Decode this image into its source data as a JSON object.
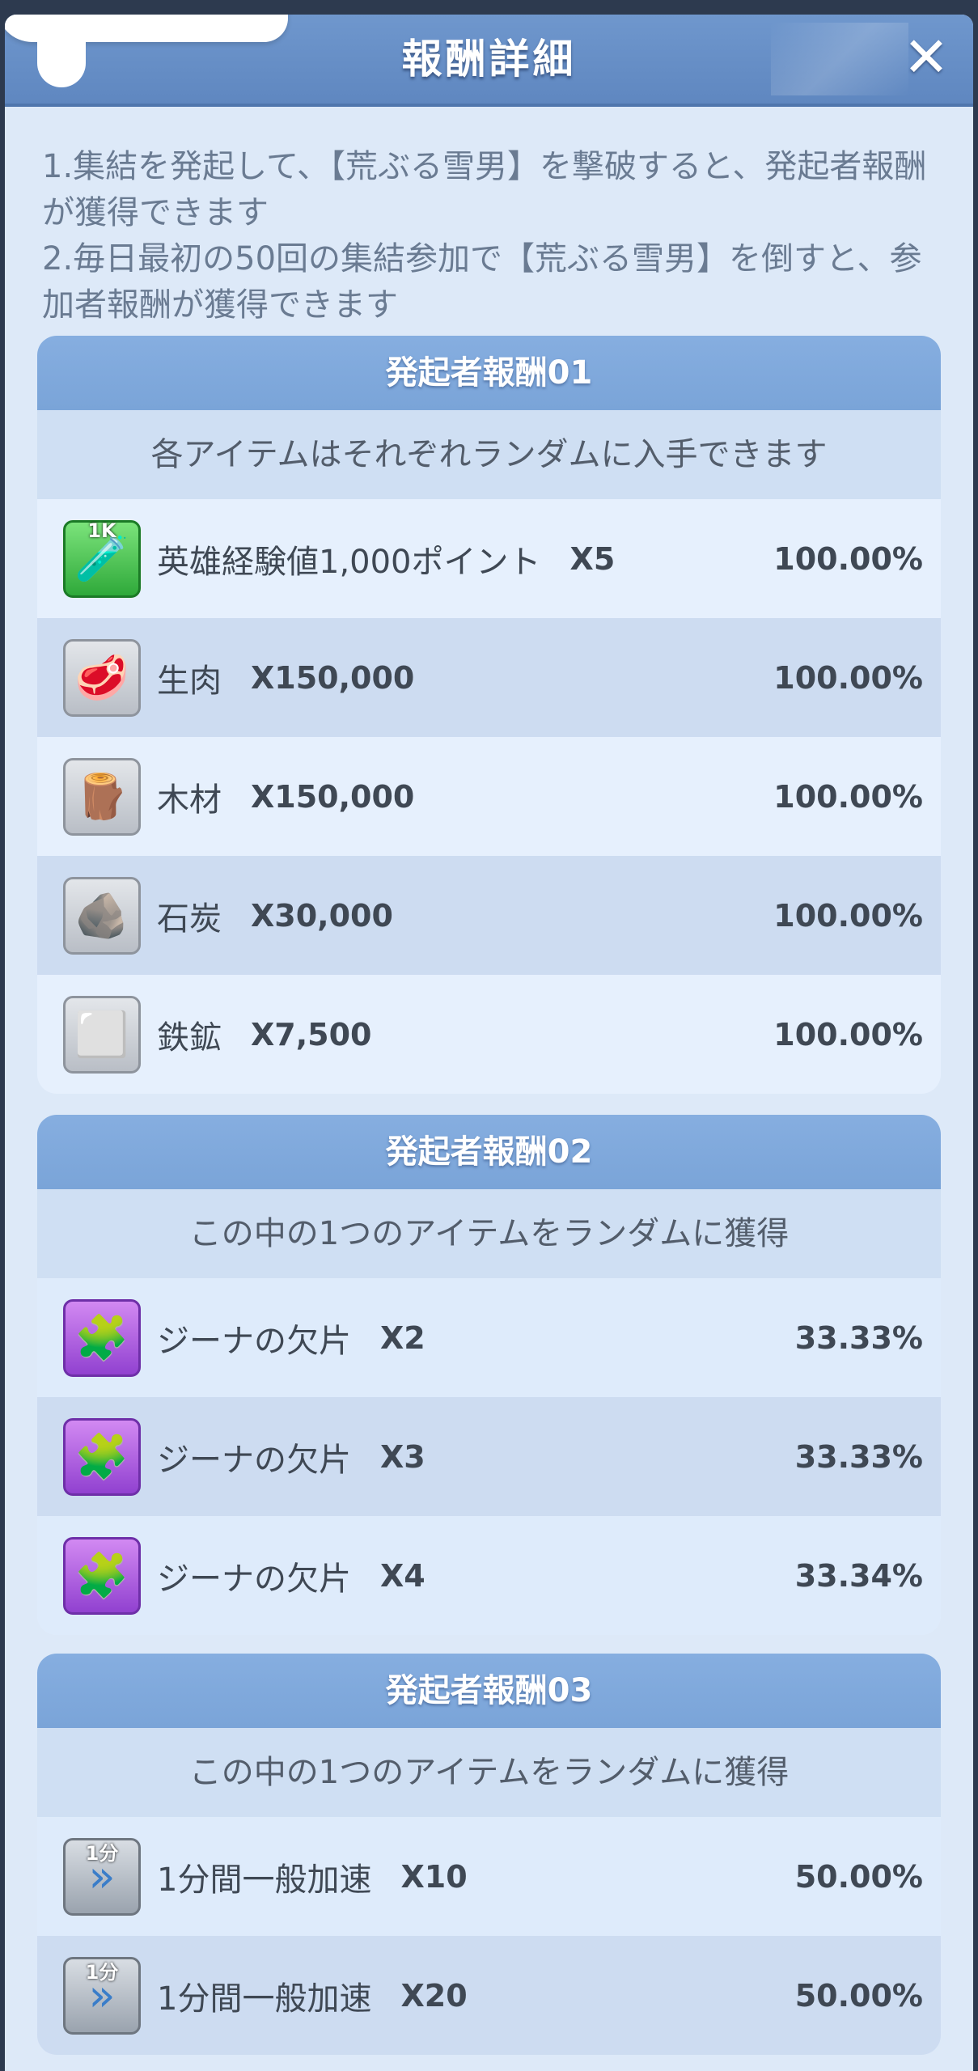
{
  "window": {
    "title": "報酬詳細",
    "close_icon": "close-icon"
  },
  "description": {
    "line1": "1.集結を発起して、【荒ぶる雪男】を撃破すると、発起者報酬が獲得できます",
    "line2": "2.毎日最初の50回の集結参加で【荒ぶる雪男】を倒すと、参加者報酬が獲得できます"
  },
  "sections": [
    {
      "title": "発起者報酬01",
      "subtitle": "各アイテムはそれぞれランダムに入手できます",
      "items": [
        {
          "icon": "exp-potion-icon",
          "icon_tag": "1K",
          "name": "英雄経験値1,000ポイント",
          "qty": "X5",
          "chance": "100.00%"
        },
        {
          "icon": "meat-icon",
          "name": "生肉",
          "qty": "X150,000",
          "chance": "100.00%"
        },
        {
          "icon": "wood-icon",
          "name": "木材",
          "qty": "X150,000",
          "chance": "100.00%"
        },
        {
          "icon": "coal-icon",
          "name": "石炭",
          "qty": "X30,000",
          "chance": "100.00%"
        },
        {
          "icon": "iron-ore-icon",
          "name": "鉄鉱",
          "qty": "X7,500",
          "chance": "100.00%"
        }
      ]
    },
    {
      "title": "発起者報酬02",
      "subtitle": "この中の1つのアイテムをランダムに獲得",
      "items": [
        {
          "icon": "hero-shard-icon",
          "name": "ジーナの欠片",
          "qty": "X2",
          "chance": "33.33%"
        },
        {
          "icon": "hero-shard-icon",
          "name": "ジーナの欠片",
          "qty": "X3",
          "chance": "33.33%"
        },
        {
          "icon": "hero-shard-icon",
          "name": "ジーナの欠片",
          "qty": "X4",
          "chance": "33.34%"
        }
      ]
    },
    {
      "title": "発起者報酬03",
      "subtitle": "この中の1つのアイテムをランダムに獲得",
      "items": [
        {
          "icon": "speedup-icon",
          "icon_tag": "1分",
          "name": "1分間一般加速",
          "qty": "X10",
          "chance": "50.00%"
        },
        {
          "icon": "speedup-icon",
          "icon_tag": "1分",
          "name": "1分間一般加速",
          "qty": "X20",
          "chance": "50.00%"
        }
      ]
    }
  ],
  "colors": {
    "header": "#5f87c0",
    "section_header": "#7aa4d8",
    "panel": "#dde9f8",
    "text": "#3f4854"
  }
}
